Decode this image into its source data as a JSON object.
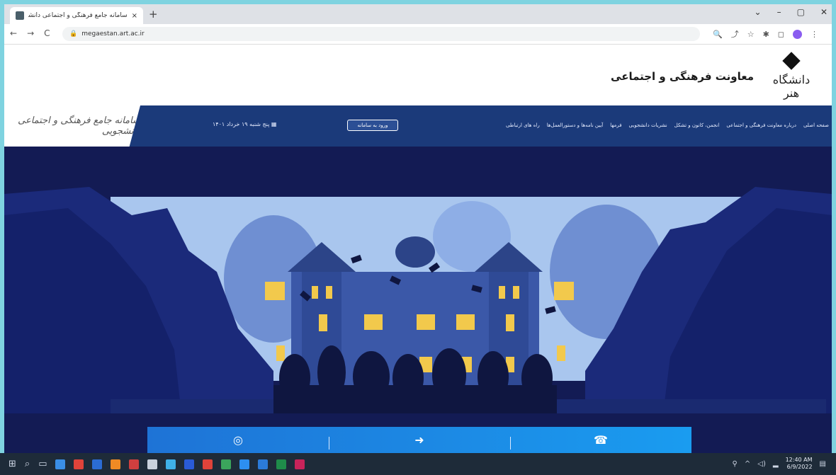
{
  "browser": {
    "tab_title": "سامانه جامع فرهنگی و اجتماعی دانشگاه",
    "tab_close": "×",
    "new_tab": "+",
    "window_controls": [
      "⌄",
      "–",
      "▢",
      "✕"
    ],
    "url": "megaestan.art.ac.ir",
    "nav": [
      "←",
      "→",
      "C"
    ],
    "toolbar_icons": [
      "🔍",
      "⤴",
      "☆",
      "✱",
      "◻"
    ]
  },
  "site": {
    "logo_text": "دانشگاه هنر",
    "org_name": "معاونت فرهنگی و اجتماعی",
    "portal_name": "سامانه جامع فرهنگی و اجتماعی دانشجویی",
    "date": "پنج شنبه ۱۹ خرداد ۱۴۰۱",
    "login_button": "ورود به سامانه",
    "menu": [
      "صفحه اصلی",
      "درباره معاونت فرهنگی و اجتماعی",
      "انجمن، کانون و تشکل",
      "نشریات دانشجویی",
      "فرمها",
      "آیین نامه‌ها و دستورالعمل‌ها",
      "راه های ارتباطی"
    ],
    "bottom_icons": [
      "chat-icon",
      "login-icon",
      "phone-icon"
    ]
  },
  "taskbar": {
    "time": "12:40 AM",
    "date": "6/9/2022"
  },
  "colors": {
    "page_bg": "#131b54",
    "navbar": "#1b3a7a",
    "accent_blue": "#1e73d6",
    "window_glow": "#f2c94c"
  }
}
